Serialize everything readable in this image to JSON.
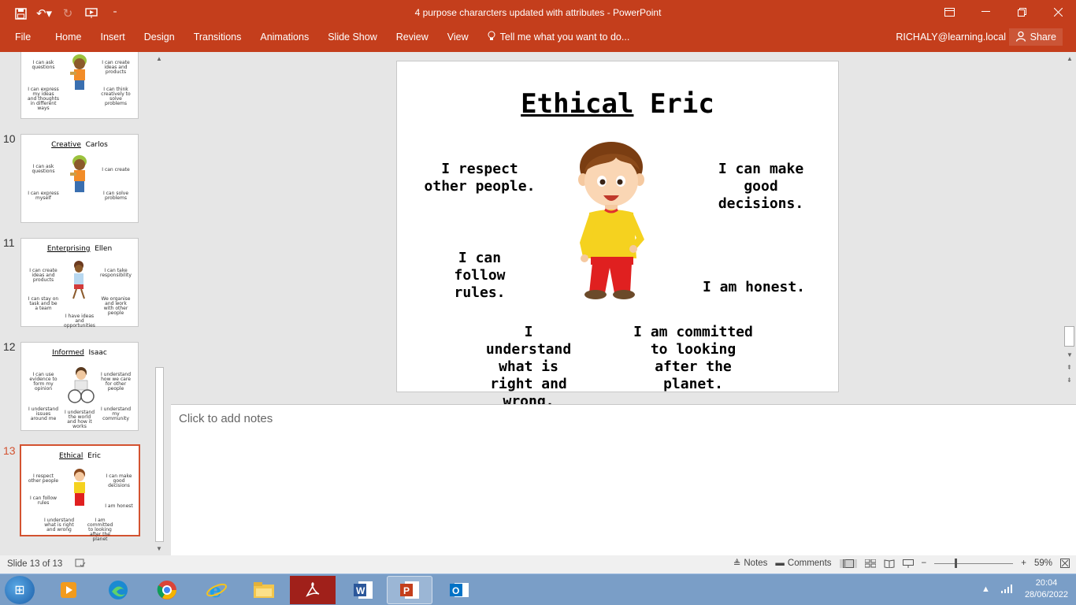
{
  "window": {
    "title": "4 purpose chararcters updated with attributes - PowerPoint",
    "controls": [
      "restore-ribbon",
      "minimize",
      "maximize",
      "close"
    ]
  },
  "quick_access": [
    "save",
    "undo",
    "redo",
    "start-from-beginning",
    "customize"
  ],
  "ribbon": {
    "tabs": [
      "File",
      "Home",
      "Insert",
      "Design",
      "Transitions",
      "Animations",
      "Slide Show",
      "Review",
      "View"
    ],
    "tell_me": "Tell me what you want to do...",
    "account": "RICHALY@learning.local",
    "share": "Share"
  },
  "thumbnails": [
    {
      "number": "",
      "title_underlined": "",
      "title_rest": "",
      "notes": [
        "I can ask questions",
        "I can express my ideas and thoughts in different ways",
        "I can create ideas and products",
        "I can think creatively to solve problems"
      ]
    },
    {
      "number": "10",
      "title_underlined": "Creative",
      "title_rest": "Carlos",
      "notes": [
        "I can ask questions",
        "I can express myself",
        "I can create",
        "I can solve problems"
      ]
    },
    {
      "number": "11",
      "title_underlined": "Enterprising",
      "title_rest": "Ellen",
      "notes": [
        "I can create ideas and products",
        "I can stay on task and be a team",
        "I can take responsibility",
        "We organise and work with other people",
        "I have ideas and opportunities"
      ]
    },
    {
      "number": "12",
      "title_underlined": "Informed",
      "title_rest": "Isaac",
      "notes": [
        "I can use evidence to form my opinion",
        "I understand how we care for other people",
        "I understand issues around me",
        "I understand the world and how it works",
        "I understand my community"
      ]
    },
    {
      "number": "13",
      "title_underlined": "Ethical",
      "title_rest": "Eric",
      "notes": [
        "I respect other people",
        "I can make good decisions",
        "I can follow rules",
        "I am honest",
        "I understand what is right and wrong",
        "I am committed to looking after the planet"
      ]
    }
  ],
  "slide": {
    "title_underlined": "Ethical",
    "title_rest": "Eric",
    "statements": {
      "respect": "I respect other people.",
      "decisions": "I can make good decisions.",
      "rules": "I can follow rules.",
      "honest": "I am honest.",
      "right_wrong": "I understand what is right and wrong.",
      "planet": "I am committed to looking after the planet."
    }
  },
  "notes_placeholder": "Click to add notes",
  "status": {
    "slide_info": "Slide 13 of 13",
    "notes_btn": "Notes",
    "comments_btn": "Comments",
    "zoom": "59%",
    "zoom_level_percent": 59
  },
  "taskbar": {
    "apps": [
      "media-player",
      "edge",
      "chrome",
      "internet-explorer",
      "file-explorer",
      "acrobat",
      "word",
      "powerpoint",
      "outlook"
    ],
    "active_app": "powerpoint",
    "time": "20:04",
    "date": "28/06/2022"
  },
  "colors": {
    "powerpoint_accent": "#c43e1c",
    "active_thumb_border": "#d35230"
  }
}
